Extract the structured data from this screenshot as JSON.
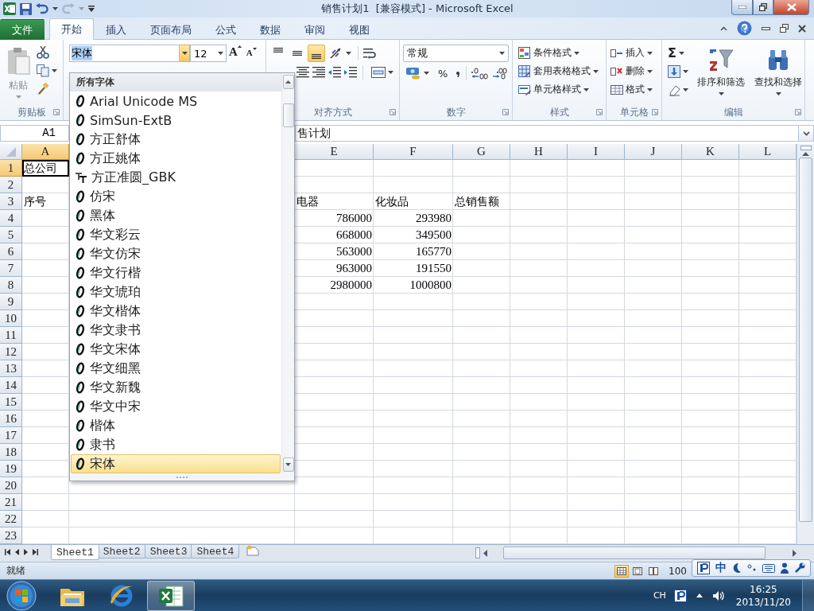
{
  "title_bar": {
    "title": "销售计划1  [兼容模式] - Microsoft Excel"
  },
  "ribbon_tabs": [
    {
      "label": "文件",
      "kind": "file",
      "selected": false
    },
    {
      "label": "开始",
      "kind": "tab",
      "selected": true
    },
    {
      "label": "插入",
      "kind": "tab",
      "selected": false
    },
    {
      "label": "页面布局",
      "kind": "tab",
      "selected": false
    },
    {
      "label": "公式",
      "kind": "tab",
      "selected": false
    },
    {
      "label": "数据",
      "kind": "tab",
      "selected": false
    },
    {
      "label": "审阅",
      "kind": "tab",
      "selected": false
    },
    {
      "label": "视图",
      "kind": "tab",
      "selected": false
    }
  ],
  "ribbon": {
    "clipboard": {
      "label": "剪贴板",
      "paste": "粘贴"
    },
    "font": {
      "font_name": "宋体",
      "font_size": "12",
      "dropdown_open": true,
      "size_buttons": [
        "A",
        "A"
      ]
    },
    "alignment": {
      "label": "对齐方式",
      "vertical": [
        {
          "selected": false
        },
        {
          "selected": false
        },
        {
          "selected": true
        }
      ]
    },
    "number": {
      "label": "数字",
      "format": "常规",
      "percent": "%"
    },
    "styles": {
      "label": "样式",
      "items": [
        "条件格式",
        "套用表格格式",
        "单元格样式"
      ]
    },
    "cells": {
      "label": "单元格",
      "items": [
        "插入",
        "删除",
        "格式"
      ]
    },
    "editing": {
      "label": "编辑",
      "autosum": "Σ",
      "items": [
        "排序和筛选",
        "查找和选择"
      ]
    }
  },
  "formula_bar": {
    "name_box": "A1",
    "content": "售计划"
  },
  "sheet": {
    "columns": [
      {
        "label": "A",
        "selected": true
      },
      {
        "label": "E",
        "selected": false
      },
      {
        "label": "F",
        "selected": false
      },
      {
        "label": "G",
        "selected": false
      },
      {
        "label": "H",
        "selected": false
      },
      {
        "label": "I",
        "selected": false
      },
      {
        "label": "J",
        "selected": false
      },
      {
        "label": "K",
        "selected": false
      },
      {
        "label": "L",
        "selected": false
      }
    ],
    "rows": [
      {
        "header": "1",
        "selected": true,
        "cells": {
          "A": {
            "text": "总公司",
            "kind": "text"
          }
        }
      },
      {
        "header": "2",
        "selected": false
      },
      {
        "header": "3",
        "selected": false,
        "cells": {
          "A": {
            "text": "序号",
            "kind": "text"
          },
          "E": {
            "text": "电器",
            "kind": "text"
          },
          "F": {
            "text": "化妆品",
            "kind": "text"
          },
          "G": {
            "text": "总销售额",
            "kind": "text"
          }
        }
      },
      {
        "header": "4",
        "selected": false,
        "cells": {
          "E": {
            "text": "786000",
            "kind": "number"
          },
          "F": {
            "text": "293980",
            "kind": "number"
          }
        }
      },
      {
        "header": "5",
        "selected": false,
        "cells": {
          "E": {
            "text": "668000",
            "kind": "number"
          },
          "F": {
            "text": "349500",
            "kind": "number"
          }
        }
      },
      {
        "header": "6",
        "selected": false,
        "cells": {
          "E": {
            "text": "563000",
            "kind": "number"
          },
          "F": {
            "text": "165770",
            "kind": "number"
          }
        }
      },
      {
        "header": "7",
        "selected": false,
        "cells": {
          "E": {
            "text": "963000",
            "kind": "number"
          },
          "F": {
            "text": "191550",
            "kind": "number"
          }
        }
      },
      {
        "header": "8",
        "selected": false,
        "cells": {
          "E": {
            "text": "2980000",
            "kind": "number"
          },
          "F": {
            "text": "1000800",
            "kind": "number"
          }
        }
      },
      {
        "header": "9",
        "selected": false
      },
      {
        "header": "10",
        "selected": false
      },
      {
        "header": "11",
        "selected": false
      },
      {
        "header": "12",
        "selected": false
      },
      {
        "header": "13",
        "selected": false
      },
      {
        "header": "14",
        "selected": false
      },
      {
        "header": "15",
        "selected": false
      },
      {
        "header": "16",
        "selected": false
      },
      {
        "header": "17",
        "selected": false
      },
      {
        "header": "18",
        "selected": false
      },
      {
        "header": "19",
        "selected": false
      },
      {
        "header": "20",
        "selected": false
      },
      {
        "header": "21",
        "selected": false
      },
      {
        "header": "22",
        "selected": false
      },
      {
        "header": "23",
        "selected": false
      }
    ]
  },
  "font_list": {
    "header": "所有字体",
    "items": [
      {
        "label": "Arial Unicode MS",
        "kind": "opentype",
        "selected": false
      },
      {
        "label": "SimSun-ExtB",
        "kind": "opentype",
        "selected": false
      },
      {
        "label": "方正舒体",
        "kind": "opentype",
        "selected": false
      },
      {
        "label": "方正姚体",
        "kind": "opentype",
        "selected": false
      },
      {
        "label": "方正准圆_GBK",
        "kind": "truetype",
        "selected": false
      },
      {
        "label": "仿宋",
        "kind": "opentype",
        "selected": false
      },
      {
        "label": "黑体",
        "kind": "opentype",
        "selected": false
      },
      {
        "label": "华文彩云",
        "kind": "opentype",
        "selected": false
      },
      {
        "label": "华文仿宋",
        "kind": "opentype",
        "selected": false
      },
      {
        "label": "华文行楷",
        "kind": "opentype",
        "selected": false
      },
      {
        "label": "华文琥珀",
        "kind": "opentype",
        "selected": false
      },
      {
        "label": "华文楷体",
        "kind": "opentype",
        "selected": false
      },
      {
        "label": "华文隶书",
        "kind": "opentype",
        "selected": false
      },
      {
        "label": "华文宋体",
        "kind": "opentype",
        "selected": false
      },
      {
        "label": "华文细黑",
        "kind": "opentype",
        "selected": false
      },
      {
        "label": "华文新魏",
        "kind": "opentype",
        "selected": false
      },
      {
        "label": "华文中宋",
        "kind": "opentype",
        "selected": false
      },
      {
        "label": "楷体",
        "kind": "opentype",
        "selected": false
      },
      {
        "label": "隶书",
        "kind": "opentype",
        "selected": false
      },
      {
        "label": "宋体",
        "kind": "opentype",
        "selected": true
      }
    ]
  },
  "sheet_tabs": [
    {
      "label": "Sheet1",
      "selected": true
    },
    {
      "label": "Sheet2",
      "selected": false
    },
    {
      "label": "Sheet3",
      "selected": false
    },
    {
      "label": "Sheet4",
      "selected": false
    }
  ],
  "status_bar": {
    "text": "就绪",
    "views": [
      {
        "selected": true
      },
      {
        "selected": false
      },
      {
        "selected": false
      }
    ],
    "zoom": "100"
  },
  "ime_bar": {
    "mode": "中"
  },
  "taskbar": {
    "apps": [
      {
        "kind": "explorer",
        "selected": false
      },
      {
        "kind": "browser",
        "selected": false
      },
      {
        "kind": "excel",
        "selected": true
      }
    ],
    "language": "CH",
    "time": "16:25",
    "date": "2013/11/20"
  }
}
